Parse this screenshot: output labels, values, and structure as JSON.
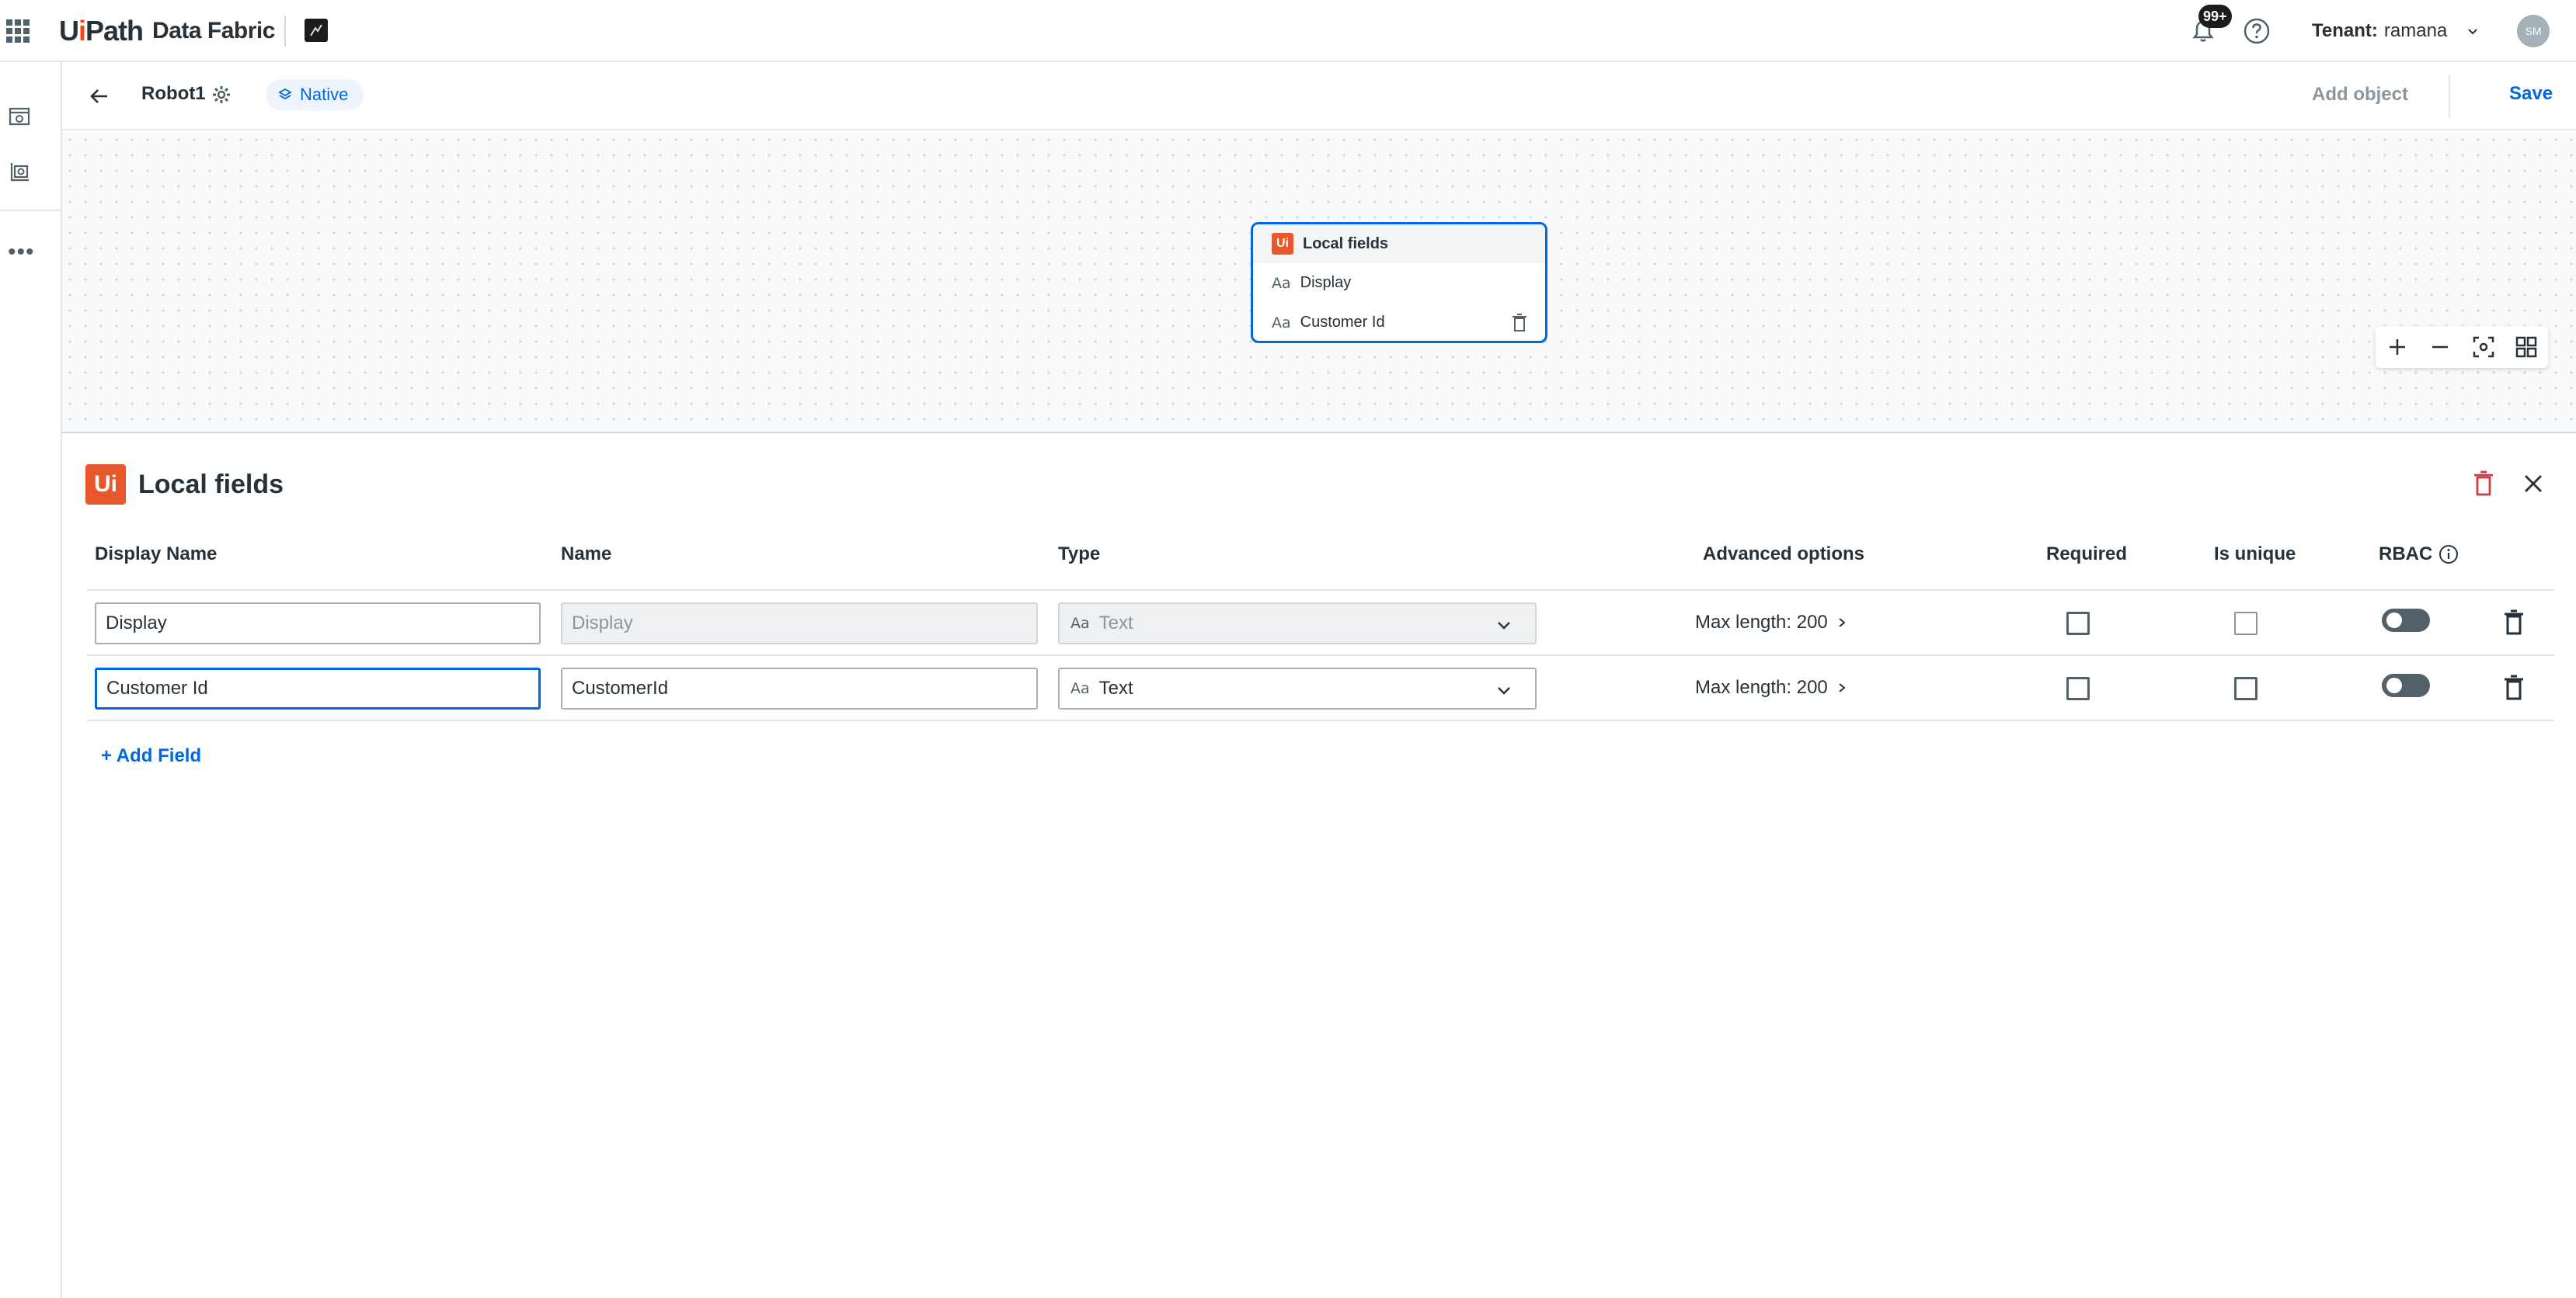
{
  "topbar": {
    "brand": "UiPath",
    "product": "Data Fabric",
    "notification_badge": "99+",
    "tenant_label": "Tenant:",
    "tenant_name": "ramana",
    "avatar_initials": "SM"
  },
  "subheader": {
    "entity_name": "Robot1",
    "badge": "Native",
    "add_object": "Add object",
    "save": "Save"
  },
  "canvas": {
    "node": {
      "title": "Local fields",
      "fields": [
        "Display",
        "Customer Id"
      ],
      "type_glyph": "Aa"
    }
  },
  "panel": {
    "title": "Local fields",
    "logo_text": "Ui",
    "columns": {
      "display_name": "Display Name",
      "name": "Name",
      "type": "Type",
      "advanced": "Advanced options",
      "required": "Required",
      "is_unique": "Is unique",
      "rbac": "RBAC"
    },
    "rows": [
      {
        "display_name": "Display",
        "name": "Display",
        "type": "Text",
        "advanced": "Max length: 200",
        "required": false,
        "is_unique": false,
        "rbac": false
      },
      {
        "display_name": "Customer Id",
        "name": "CustomerId",
        "type": "Text",
        "advanced": "Max length: 200",
        "required": false,
        "is_unique": false,
        "rbac": false
      }
    ],
    "add_field": "+ Add Field"
  },
  "colors": {
    "accent": "#0067df",
    "brand_orange": "#fa4616",
    "text": "#273139",
    "muted": "#8a97a0",
    "danger": "#cc3d45"
  }
}
